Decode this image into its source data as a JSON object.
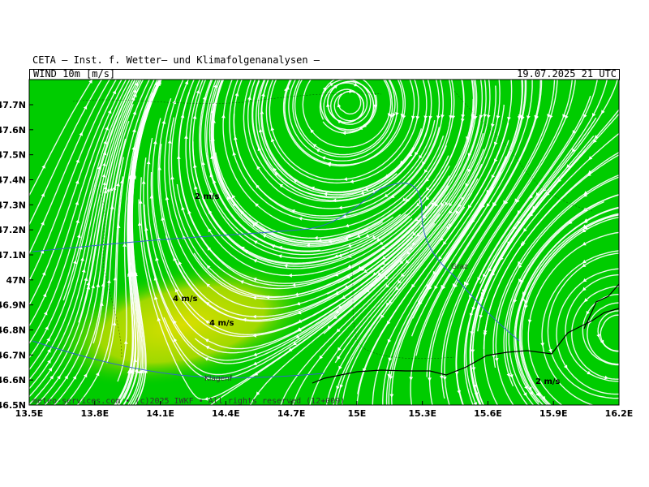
{
  "header": {
    "title": "CETA – Inst. f. Wetter– und Klimafolgenanalysen –",
    "variable": "WIND_10m_[m/s]",
    "datetime": "19.07.2025 21 UTC"
  },
  "axes": {
    "lon_ticks": [
      "13.5E",
      "13.8E",
      "14.1E",
      "14.4E",
      "14.7E",
      "15E",
      "15.3E",
      "15.6E",
      "15.9E",
      "16.2E"
    ],
    "lat_ticks": [
      "47.7N",
      "47.6N",
      "47.5N",
      "47.4N",
      "47.3N",
      "47.2N",
      "47.1N",
      "47N",
      "46.9N",
      "46.8N",
      "46.7N",
      "46.6N",
      "46.5N"
    ],
    "lon_range": [
      13.5,
      16.2
    ],
    "lat_range": [
      46.5,
      47.9
    ]
  },
  "labels": {
    "contour_1": "2 m/s",
    "contour_2": "4 m/s",
    "contour_3": "4 m/s",
    "contour_4": "2 m/s",
    "city_1": "Graz",
    "city_2": "Klagenf"
  },
  "credit": "meteo-services.com • (c)2025 IWKF • All rights reserved (12+009)",
  "colors": {
    "wind_low": "#00cc00",
    "wind_high": "#d8e000",
    "streamline": "#ffffff",
    "border": "#000000",
    "river": "#3366cc"
  }
}
